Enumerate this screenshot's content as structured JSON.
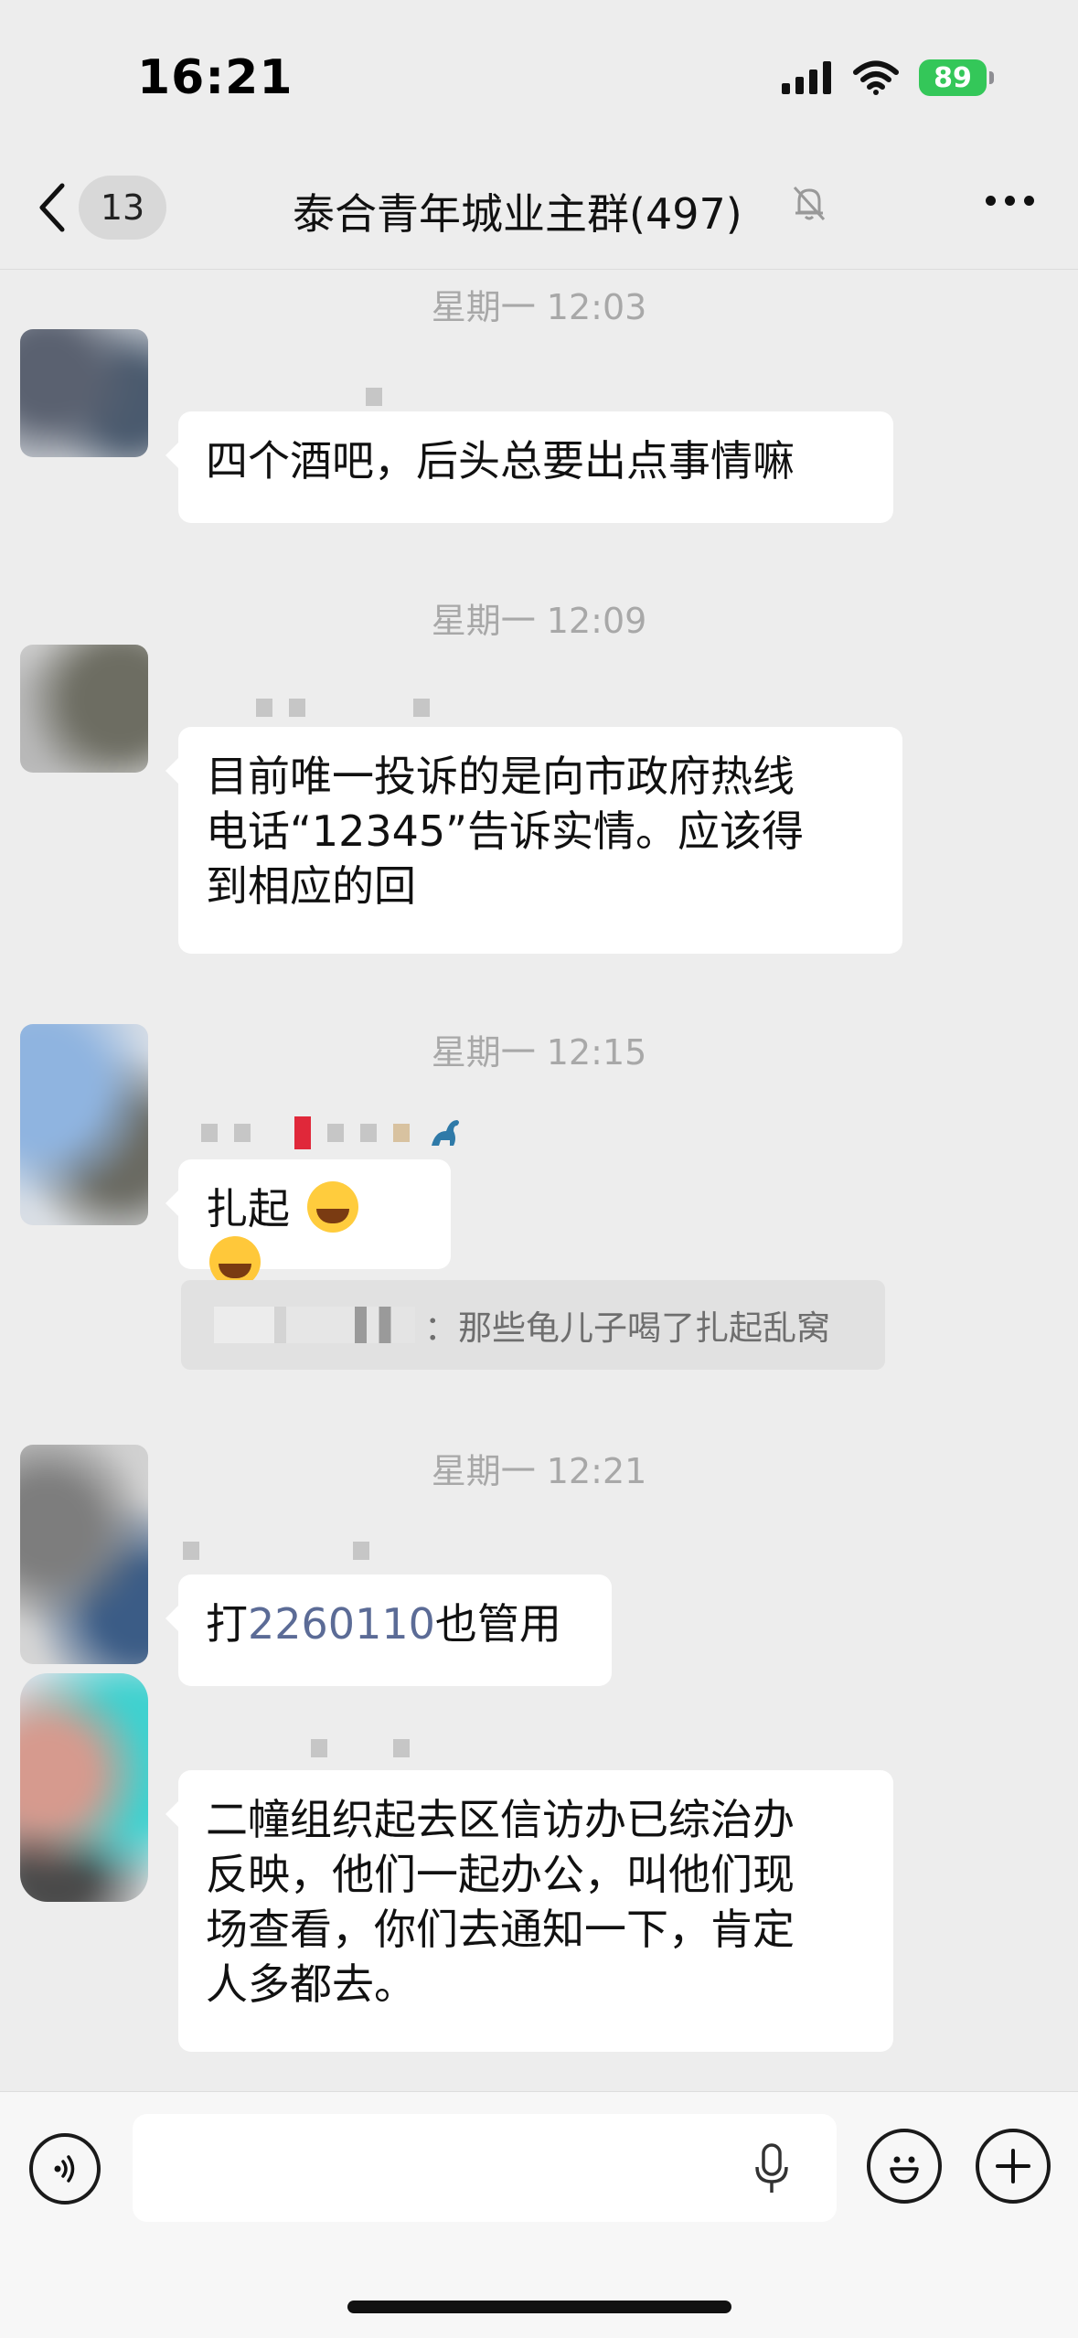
{
  "status_bar": {
    "time": "16:21",
    "battery": "89"
  },
  "header": {
    "back_count": "13",
    "title": "泰合青年城业主群(497)",
    "icons": [
      "back-chevron-icon",
      "mute-bell-icon",
      "more-dots-icon"
    ]
  },
  "messages": [
    {
      "timestamp": "星期一 12:03",
      "text": "四个酒吧，后头总要出点事情嘛"
    },
    {
      "timestamp": "星期一 12:09",
      "lines": [
        "目前唯一投诉的是向市政府热线",
        "电话“12345”告诉实情。应该得",
        "到相应的回"
      ]
    },
    {
      "timestamp": "星期一 12:15",
      "text": "扎起",
      "quote": "：那些龟儿子喝了扎起乱窝"
    },
    {
      "timestamp": "星期一 12:21",
      "text_prefix": "打",
      "text_number": "2260110",
      "text_suffix": "也管用"
    },
    {
      "lines": [
        "二幢组织起去区信访办已综治办",
        "反映，他们一起办公，叫他们现",
        "场查看，你们去通知一下，肯定",
        "人多都去。"
      ]
    }
  ],
  "input_bar": {
    "placeholder": "",
    "icons": [
      "voice-toggle-icon",
      "microphone-icon",
      "emoji-icon",
      "plus-icon"
    ]
  },
  "colors": {
    "background": "#ededed",
    "bubble": "#ffffff",
    "link": "#5b6b96",
    "battery": "#34c759"
  }
}
